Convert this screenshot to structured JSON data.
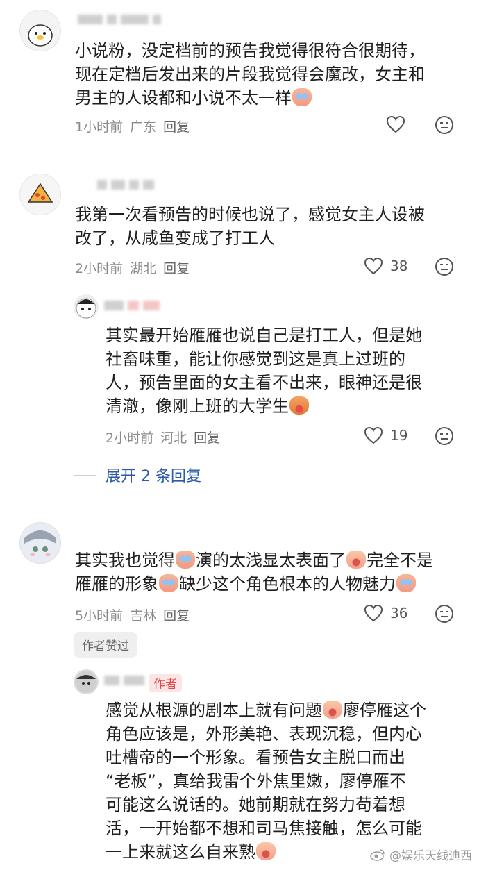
{
  "comments": [
    {
      "lines": [
        "小说粉，没定档前的预告我觉得很符合很期待，",
        "现在定档后发出来的片段我觉得会魔改，女主和",
        "男主的人设都和小说不太一样"
      ],
      "time": "1小时前",
      "location": "广东",
      "reply": "回复",
      "likes": ""
    },
    {
      "lines": [
        "我第一次看预告的时候也说了，感觉女主人设被",
        "改了，从咸鱼变成了打工人"
      ],
      "time": "2小时前",
      "location": "湖北",
      "reply": "回复",
      "likes": "38",
      "sub_reply": {
        "lines": [
          "其实最开始雁雁也说自己是打工人，但是她",
          "社畜味重，能让你感觉到这是真上过班的",
          "人，预告里面的女主看不出来，眼神还是很",
          "清澈，像刚上班的大学生"
        ],
        "time": "2小时前",
        "location": "河北",
        "reply": "回复",
        "likes": "19"
      },
      "expand": "展开 2 条回复"
    },
    {
      "line1_a": "其实我也觉得",
      "line1_b": "演的太浅显太表面了",
      "line1_c": "完全不是",
      "line2_a": "雁雁的形象",
      "line2_b": "缺少这个角色根本的人物魅力",
      "time": "5小时前",
      "location": "吉林",
      "reply": "回复",
      "likes": "36",
      "liked_badge": "作者赞过",
      "author_reply": {
        "author_tag": "作者",
        "line1_a": "感觉从根源的剧本上就有问题",
        "line1_b": "廖停雁这个",
        "lines": [
          "角色应该是，外形美艳、表现沉稳，但内心",
          "吐槽帝的一个形象。看预告女主脱口而出",
          "“老板”，真给我雷个外焦里嫩，廖停雁不",
          "可能这么说话的。她前期就在努力苟着想",
          "活，一开始都不想和司马焦接触，怎么可能"
        ],
        "last_line": "一上来就这么自来熟"
      }
    }
  ],
  "watermark": "@娱乐天线迪西",
  "colors": {
    "link": "#2b5aa8",
    "author_tag_bg": "#fde5e5",
    "author_tag_fg": "#e24a4a"
  }
}
